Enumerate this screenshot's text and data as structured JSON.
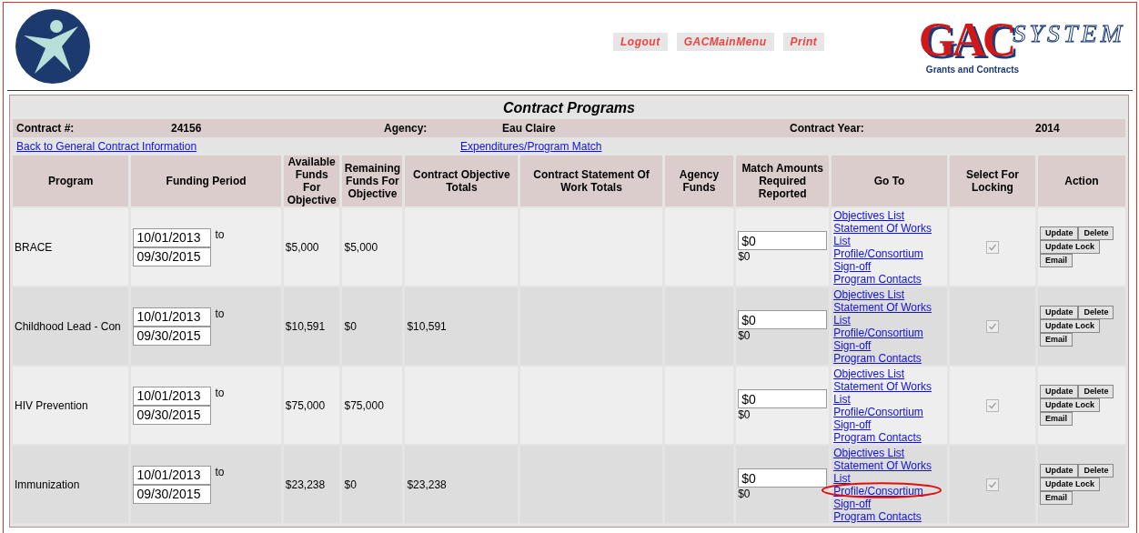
{
  "header": {
    "nav": [
      "Logout",
      "GACMainMenu",
      "Print"
    ],
    "brand": {
      "letters": "GAC",
      "word": "SYSTEM",
      "tagline": "Grants and Contracts"
    }
  },
  "panel": {
    "title": "Contract Programs",
    "info": [
      {
        "label": "Contract #:",
        "value": "24156"
      },
      {
        "label": "Agency:",
        "value": "Eau Claire"
      },
      {
        "label": "Contract Year:",
        "value": "2014"
      }
    ],
    "links": [
      "Back to General Contract Information",
      "Expenditures/Program Match"
    ]
  },
  "table": {
    "columns": [
      "Program",
      "Funding Period",
      "Available Funds For Objective",
      "Remaining Funds For Objective",
      "Contract Objective Totals",
      "Contract Statement Of Work Totals",
      "Agency Funds",
      "Match Amounts Required Reported",
      "Go To",
      "Select For Locking",
      "Action"
    ],
    "rows": [
      {
        "program": "BRACE",
        "start": "10/01/2013",
        "to": "to",
        "end": "09/30/2015",
        "available": "$5,000",
        "remaining": "$5,000",
        "objective_totals": "",
        "match_value": "$0",
        "match_reported": "$0",
        "links": [
          "Objectives List",
          "Statement Of Works List",
          "Profile/Consortium Sign-off",
          "Program Contacts"
        ],
        "circled": false,
        "locked": {
          "checked": true,
          "disabled": true
        },
        "actions": [
          "Update",
          "Delete",
          "Update Lock",
          "Email"
        ]
      },
      {
        "program": "Childhood Lead - Con",
        "start": "10/01/2013",
        "to": "to",
        "end": "09/30/2015",
        "available": "$10,591",
        "remaining": "$0",
        "objective_totals": "$10,591",
        "match_value": "$0",
        "match_reported": "$0",
        "links": [
          "Objectives List",
          "Statement Of Works List",
          "Profile/Consortium Sign-off",
          "Program Contacts"
        ],
        "circled": false,
        "locked": {
          "checked": true,
          "disabled": true
        },
        "actions": [
          "Update",
          "Delete",
          "Update Lock",
          "Email"
        ]
      },
      {
        "program": "HIV Prevention",
        "start": "10/01/2013",
        "to": "to",
        "end": "09/30/2015",
        "available": "$75,000",
        "remaining": "$75,000",
        "objective_totals": "",
        "match_value": "$0",
        "match_reported": "$0",
        "links": [
          "Objectives List",
          "Statement Of Works List",
          "Profile/Consortium Sign-off",
          "Program Contacts"
        ],
        "circled": false,
        "locked": {
          "checked": true,
          "disabled": true
        },
        "actions": [
          "Update",
          "Delete",
          "Update Lock",
          "Email"
        ]
      },
      {
        "program": "Immunization",
        "start": "10/01/2013",
        "to": "to",
        "end": "09/30/2015",
        "available": "$23,238",
        "remaining": "$0",
        "objective_totals": "$23,238",
        "match_value": "$0",
        "match_reported": "$0",
        "links": [
          "Objectives List",
          "Statement Of Works List",
          "Profile/Consortium Sign-off",
          "Program Contacts"
        ],
        "circled": true,
        "locked": {
          "checked": true,
          "disabled": true
        },
        "actions": [
          "Update",
          "Delete",
          "Update Lock",
          "Email"
        ]
      }
    ]
  }
}
